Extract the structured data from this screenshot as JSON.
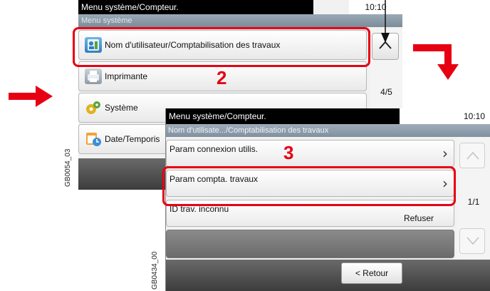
{
  "screen1": {
    "title": "Menu système/Compteur.",
    "time": "10:10",
    "subtitle": "Menu système",
    "items": [
      {
        "label": "Nom d'utilisateur/Comptabilisation des travaux",
        "icon": "user-accounting-icon"
      },
      {
        "label": "Imprimante",
        "icon": "printer-icon"
      },
      {
        "label": "Système",
        "icon": "system-icon"
      },
      {
        "label": "Date/Temporis",
        "icon": "date-timer-icon"
      }
    ],
    "page": "4/5",
    "code": "GB0054_03"
  },
  "screen2": {
    "title": "Menu système/Compteur.",
    "time": "10:10",
    "subtitle": "Nom d'utilisate.../Comptabilisation des travaux",
    "rows": [
      {
        "label": "Param connexion utilis.",
        "value": ""
      },
      {
        "label": "Param compta. travaux",
        "value": ""
      },
      {
        "label": "ID trav. inconnu",
        "value": "Refuser"
      }
    ],
    "page": "1/1",
    "back_label": "< Retour",
    "code": "GB0434_00"
  },
  "annotations": {
    "step2": "2",
    "step3": "3",
    "highlight_color": "#e60012"
  }
}
